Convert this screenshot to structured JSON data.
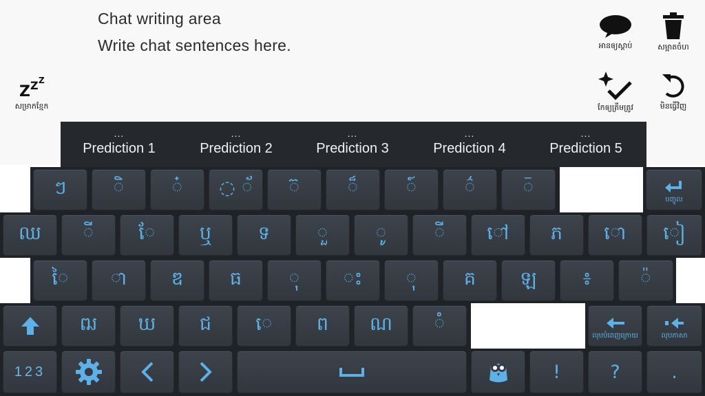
{
  "chat": {
    "title": "Chat writing area",
    "placeholder": "Write chat sentences here."
  },
  "toolbar": {
    "sleep": {
      "icon": "zzz-icon",
      "label": "សម្រាកខ្មែក"
    },
    "read_aloud": {
      "icon": "speech-bubble-icon",
      "label": "អានឲ្យស្ដាប់"
    },
    "clear": {
      "icon": "trash-icon",
      "label": "សម្អាតចំហ"
    },
    "correct": {
      "icon": "sparkle-check-icon",
      "label": "កែឲ្យត្រឹមត្រូវ"
    },
    "undo": {
      "icon": "undo-icon",
      "label": "មិនធ្វើវិញ"
    }
  },
  "predictions": [
    {
      "label": "Prediction 1",
      "more": "..."
    },
    {
      "label": "Prediction 2",
      "more": "..."
    },
    {
      "label": "Prediction 3",
      "more": "..."
    },
    {
      "label": "Prediction 4",
      "more": "..."
    },
    {
      "label": "Prediction 5",
      "more": "..."
    }
  ],
  "keyboard": {
    "row1": [
      "ៗ",
      "◌ិ",
      "៎",
      "◌ ័",
      "◌៊",
      "◌៏",
      "◌៍",
      "◌៌",
      "◌៑"
    ],
    "enter": {
      "icon": "return-arrow-icon",
      "label": "បញ្ចូល"
    },
    "row2": [
      "ឈ",
      "◌ី",
      "◌ែ",
      "ឬ",
      "ទ",
      "◌ួ",
      "◌ូ",
      "◌ី",
      "◌ៅ",
      "ភ",
      "◌ោ",
      "◌ៀ"
    ],
    "row3": [
      "◌ៃ",
      "◌ា",
      "ឌ",
      "ធ",
      "◌ុ",
      "◌ះ",
      "◌ុ",
      "គ",
      "ឡ",
      "៖",
      "◌៉"
    ],
    "row4": [
      "ឍ",
      "ឃ",
      "ជ",
      "◌េ",
      "ព",
      "ណ",
      "◌ំ"
    ],
    "shift": {
      "icon": "shift-up-icon"
    },
    "delete_word": {
      "icon": "left-arrow-icon",
      "label": "លុបបំពេញក្រោយ"
    },
    "delete_char": {
      "icon": "backspace-arrow-icon",
      "label": "លុបភាសា"
    },
    "numbers": "123",
    "settings": {
      "icon": "gear-icon"
    },
    "left": {
      "icon": "chevron-left-icon",
      "glyph": "‹"
    },
    "right": {
      "icon": "chevron-right-icon",
      "glyph": "›"
    },
    "space": {
      "icon": "spacebar-icon",
      "glyph": "␣"
    },
    "mascot": {
      "icon": "owl-mascot-icon"
    },
    "exclaim": "!",
    "question": "?",
    "period": "."
  },
  "colors": {
    "key_text": "#5eb1e6",
    "key_bg": "#363b43",
    "prediction_bar": "#25282d"
  }
}
